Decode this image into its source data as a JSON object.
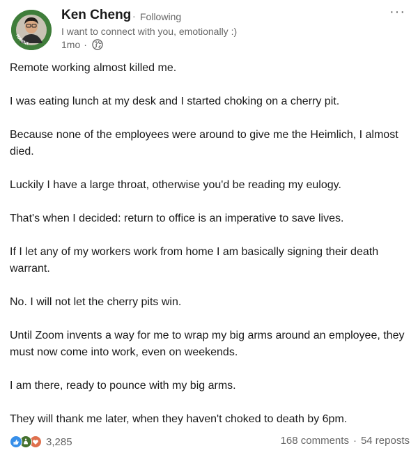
{
  "post": {
    "author": {
      "name": "Ken Cheng",
      "follow_status": "Following",
      "headline": "I want to connect with you, emotionally :)",
      "time_ago": "1mo",
      "avatar_badge": "#OPENTOWORK"
    },
    "more_label": "···",
    "separator": "·",
    "paragraphs": [
      "Remote working almost killed me.",
      "I was eating lunch at my desk and I started choking on a cherry pit.",
      "Because none of the employees were around to give me the Heimlich, I almost died.",
      "Luckily I have a large throat, otherwise you'd be reading my eulogy.",
      "That's when I decided: return to office is an imperative to save lives.",
      "If I let any of my workers work from home I am basically signing their death warrant.",
      "No. I will not let the cherry pits win.",
      "Until Zoom invents a way for me to wrap my big arms around an employee, they must now come into work, even on weekends.",
      "I am there, ready to pounce with my big arms.",
      "They will thank me later, when they haven't choked to death by 6pm."
    ],
    "social": {
      "reaction_count": "3,285",
      "comments": "168 comments",
      "reposts": "54 reposts",
      "reaction_icons": [
        "like-icon",
        "celebrate-icon",
        "love-icon"
      ]
    }
  },
  "colors": {
    "like": "#378fe9",
    "celebrate": "#44712e",
    "love": "#df704d",
    "open_to_work": "#3f7d3a"
  }
}
